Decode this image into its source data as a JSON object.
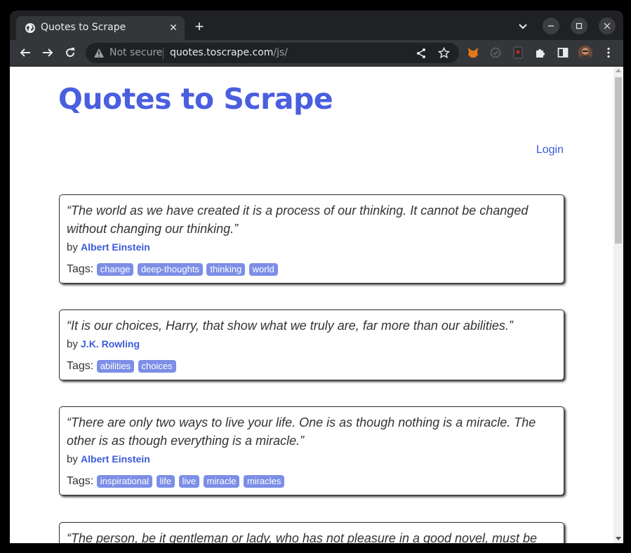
{
  "browser": {
    "tab_title": "Quotes to Scrape",
    "security_label": "Not secure",
    "url_host": "quotes.toscrape.com",
    "url_path": "/js/"
  },
  "site": {
    "title": "Quotes to Scrape",
    "login_label": "Login",
    "tags_label": "Tags:",
    "by_label": "by"
  },
  "quotes": [
    {
      "text": "“The world as we have created it is a process of our thinking. It cannot be changed without changing our thinking.”",
      "author": "Albert Einstein",
      "tags": [
        "change",
        "deep-thoughts",
        "thinking",
        "world"
      ]
    },
    {
      "text": "“It is our choices, Harry, that show what we truly are, far more than our abilities.”",
      "author": "J.K. Rowling",
      "tags": [
        "abilities",
        "choices"
      ]
    },
    {
      "text": "“There are only two ways to live your life. One is as though nothing is a miracle. The other is as though everything is a miracle.”",
      "author": "Albert Einstein",
      "tags": [
        "inspirational",
        "life",
        "live",
        "miracle",
        "miracles"
      ]
    },
    {
      "text": "“The person, be it gentleman or lady, who has not pleasure in a good novel, must be",
      "author": "",
      "tags": []
    }
  ],
  "colors": {
    "accent": "#4a5ee0",
    "tag_bg": "#7c8ee6",
    "author": "#3b5bdb"
  }
}
